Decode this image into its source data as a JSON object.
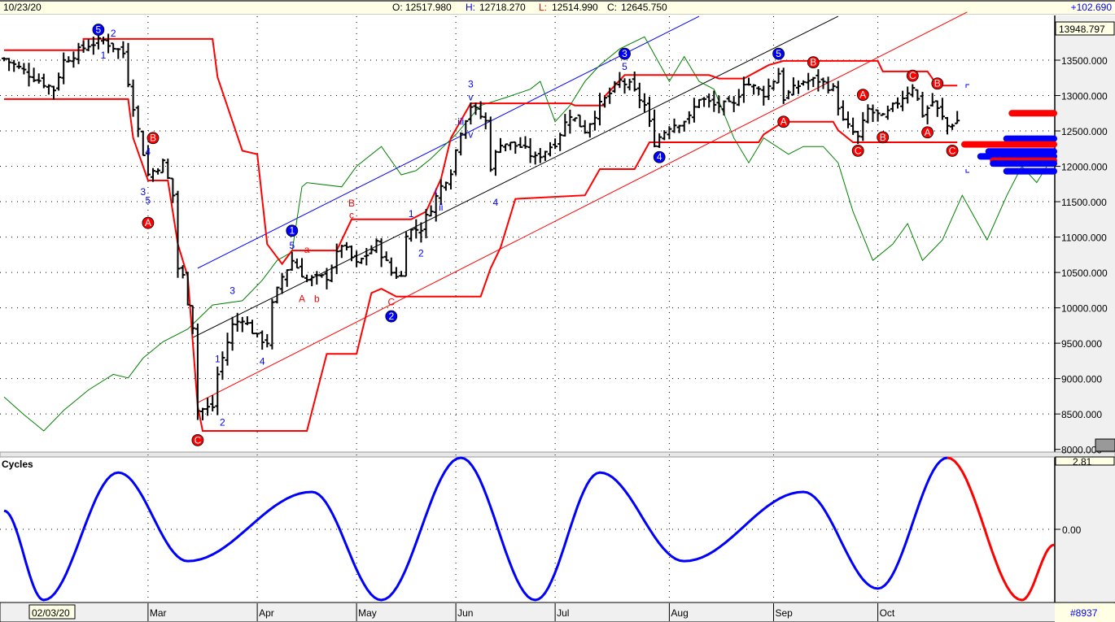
{
  "header": {
    "date": "10/23/20",
    "open_label": "O:",
    "open": "12517.980",
    "high_label": "H:",
    "high": "12718.270",
    "low_label": "L:",
    "low": "12514.990",
    "close_label": "C:",
    "close": "12645.750",
    "change": "+102.690"
  },
  "colors": {
    "up_down_bar": "#000000",
    "channel_band": "#ff0000",
    "green_line": "#008000",
    "blue": "#0000ff",
    "red": "#ff0000"
  },
  "footer": {
    "start_date": "02/03/20",
    "bar_count": "#8937"
  },
  "chart_data": [
    {
      "type": "line",
      "title": "Price (OHLC bars)",
      "ylim": [
        8000,
        14100
      ],
      "y_ticks": [
        "8000.000",
        "8500.000",
        "9000.000",
        "9500.000",
        "10000.000",
        "10500.000",
        "11000.000",
        "11500.000",
        "12000.000",
        "12500.000",
        "13000.000",
        "13500.000"
      ],
      "y_tick_values": [
        8000,
        8500,
        9000,
        9500,
        10000,
        10500,
        11000,
        11500,
        12000,
        12500,
        13000,
        13500
      ],
      "last_value_box": "13948.797",
      "x_days_total": 212,
      "month_ticks": [
        {
          "label": "Mar",
          "day": 29
        },
        {
          "label": "Apr",
          "day": 51
        },
        {
          "label": "May",
          "day": 71
        },
        {
          "label": "Jun",
          "day": 91
        },
        {
          "label": "Jul",
          "day": 111
        },
        {
          "label": "Aug",
          "day": 134
        },
        {
          "label": "Sep",
          "day": 155
        },
        {
          "label": "Oct",
          "day": 176
        }
      ],
      "close_path": [
        [
          0,
          13520
        ],
        [
          6,
          13260
        ],
        [
          10,
          13090
        ],
        [
          12,
          13490
        ],
        [
          17,
          13720
        ],
        [
          20,
          13780
        ],
        [
          24,
          13600
        ],
        [
          25,
          13200
        ],
        [
          27,
          12510
        ],
        [
          29,
          11880
        ],
        [
          32,
          12050
        ],
        [
          34,
          11590
        ],
        [
          35,
          10560
        ],
        [
          36,
          10440
        ],
        [
          38,
          9750
        ],
        [
          39,
          8550
        ],
        [
          42,
          8600
        ],
        [
          43,
          9060
        ],
        [
          46,
          9750
        ],
        [
          48,
          9860
        ],
        [
          51,
          9580
        ],
        [
          53,
          9520
        ],
        [
          54,
          10040
        ],
        [
          56,
          10440
        ],
        [
          58,
          10670
        ],
        [
          61,
          10390
        ],
        [
          65,
          10440
        ],
        [
          68,
          10900
        ],
        [
          71,
          10610
        ],
        [
          75,
          10900
        ],
        [
          78,
          10500
        ],
        [
          80,
          10440
        ],
        [
          81,
          11070
        ],
        [
          84,
          11130
        ],
        [
          88,
          11710
        ],
        [
          90,
          11940
        ],
        [
          92,
          12510
        ],
        [
          94,
          12860
        ],
        [
          97,
          12630
        ],
        [
          98,
          12000
        ],
        [
          100,
          12340
        ],
        [
          104,
          12280
        ],
        [
          107,
          12110
        ],
        [
          111,
          12340
        ],
        [
          114,
          12740
        ],
        [
          117,
          12510
        ],
        [
          120,
          12860
        ],
        [
          124,
          13200
        ],
        [
          126,
          13140
        ],
        [
          129,
          12860
        ],
        [
          131,
          12340
        ],
        [
          134,
          12570
        ],
        [
          138,
          12680
        ],
        [
          140,
          12970
        ],
        [
          143,
          12860
        ],
        [
          147,
          12860
        ],
        [
          149,
          13200
        ],
        [
          153,
          13030
        ],
        [
          156,
          13320
        ],
        [
          157,
          12970
        ],
        [
          161,
          13200
        ],
        [
          164,
          13220
        ],
        [
          167,
          13090
        ],
        [
          169,
          12630
        ],
        [
          172,
          12400
        ],
        [
          174,
          12800
        ],
        [
          177,
          12680
        ],
        [
          180,
          12910
        ],
        [
          183,
          13140
        ],
        [
          185,
          12740
        ],
        [
          187,
          12910
        ],
        [
          190,
          12570
        ],
        [
          192,
          12645
        ]
      ],
      "upper_band": [
        [
          0,
          13640
        ],
        [
          16,
          13640
        ],
        [
          16,
          13800
        ],
        [
          42,
          13800
        ],
        [
          43,
          13260
        ],
        [
          48,
          12220
        ],
        [
          51,
          12170
        ],
        [
          53,
          10900
        ],
        [
          56,
          10620
        ],
        [
          58,
          10810
        ],
        [
          67,
          10810
        ],
        [
          70,
          11250
        ],
        [
          82,
          11250
        ],
        [
          85,
          11360
        ],
        [
          88,
          11820
        ],
        [
          90,
          12400
        ],
        [
          94,
          12890
        ],
        [
          114,
          12890
        ],
        [
          115,
          12860
        ],
        [
          121,
          12860
        ],
        [
          121,
          12990
        ],
        [
          125,
          13290
        ],
        [
          142,
          13290
        ],
        [
          144,
          13240
        ],
        [
          149,
          13240
        ],
        [
          154,
          13430
        ],
        [
          157,
          13490
        ],
        [
          176,
          13490
        ],
        [
          177,
          13340
        ],
        [
          186,
          13340
        ],
        [
          188,
          13140
        ],
        [
          192,
          13140
        ]
      ],
      "lower_band": [
        [
          0,
          12950
        ],
        [
          25,
          12950
        ],
        [
          26,
          12400
        ],
        [
          29,
          11800
        ],
        [
          33,
          11800
        ],
        [
          35,
          10900
        ],
        [
          37,
          10440
        ],
        [
          39,
          8610
        ],
        [
          40,
          8260
        ],
        [
          61,
          8260
        ],
        [
          65,
          9350
        ],
        [
          71,
          9350
        ],
        [
          74,
          10210
        ],
        [
          76,
          10270
        ],
        [
          79,
          10160
        ],
        [
          96,
          10160
        ],
        [
          98,
          10560
        ],
        [
          100,
          10850
        ],
        [
          103,
          11540
        ],
        [
          117,
          11590
        ],
        [
          120,
          11960
        ],
        [
          127,
          11960
        ],
        [
          130,
          12340
        ],
        [
          152,
          12340
        ],
        [
          153,
          12450
        ],
        [
          157,
          12630
        ],
        [
          167,
          12630
        ],
        [
          168,
          12510
        ],
        [
          171,
          12340
        ],
        [
          192,
          12340
        ]
      ],
      "green_line": [
        [
          0,
          8740
        ],
        [
          4,
          8490
        ],
        [
          8,
          8260
        ],
        [
          12,
          8550
        ],
        [
          17,
          8840
        ],
        [
          22,
          9060
        ],
        [
          25,
          9010
        ],
        [
          28,
          9290
        ],
        [
          32,
          9520
        ],
        [
          37,
          9700
        ],
        [
          42,
          10040
        ],
        [
          48,
          10100
        ],
        [
          52,
          10390
        ],
        [
          55,
          10670
        ],
        [
          58,
          10790
        ],
        [
          60,
          11710
        ],
        [
          61,
          11770
        ],
        [
          68,
          11710
        ],
        [
          71,
          12000
        ],
        [
          76,
          12280
        ],
        [
          80,
          11880
        ],
        [
          83,
          11940
        ],
        [
          86,
          12110
        ],
        [
          91,
          12450
        ],
        [
          96,
          12860
        ],
        [
          101,
          12970
        ],
        [
          106,
          13090
        ],
        [
          108,
          13200
        ],
        [
          111,
          12630
        ],
        [
          114,
          12860
        ],
        [
          117,
          13200
        ],
        [
          120,
          13430
        ],
        [
          124,
          13660
        ],
        [
          129,
          13830
        ],
        [
          134,
          13200
        ],
        [
          137,
          13550
        ],
        [
          140,
          13200
        ],
        [
          143,
          13090
        ],
        [
          147,
          12400
        ],
        [
          150,
          12050
        ],
        [
          153,
          12400
        ],
        [
          158,
          12170
        ],
        [
          161,
          12280
        ],
        [
          165,
          12280
        ],
        [
          168,
          12050
        ],
        [
          171,
          11360
        ],
        [
          175,
          10670
        ],
        [
          179,
          10900
        ],
        [
          182,
          11190
        ],
        [
          185,
          10670
        ],
        [
          189,
          10960
        ],
        [
          193,
          11590
        ],
        [
          198,
          10960
        ],
        [
          202,
          11590
        ],
        [
          205,
          12000
        ],
        [
          208,
          11770
        ],
        [
          211,
          12110
        ]
      ],
      "trend_lines": [
        {
          "color": "#0000ff",
          "from": [
            39,
            10560
          ],
          "to": [
            140,
            14120
          ]
        },
        {
          "color": "#000000",
          "from": [
            38,
            9580
          ],
          "to": [
            168,
            14120
          ]
        },
        {
          "color": "#ff0000",
          "from": [
            39,
            8660
          ],
          "to": [
            194,
            14180
          ]
        }
      ],
      "volume_profile": [
        {
          "price": 12750,
          "size": 0.47,
          "color": "#ff0000"
        },
        {
          "price": 12390,
          "size": 0.53,
          "color": "#0000ff"
        },
        {
          "price": 12310,
          "size": 1.0,
          "color": "#ff0000"
        },
        {
          "price": 12210,
          "size": 0.73,
          "color": "#0000ff"
        },
        {
          "price": 12140,
          "size": 0.82,
          "color": "#0000ff"
        },
        {
          "price": 12080,
          "size": 0.68,
          "color": "#ff0000"
        },
        {
          "price": 12040,
          "size": 0.68,
          "color": "#0000ff"
        },
        {
          "price": 11930,
          "size": 0.53,
          "color": "#0000ff"
        }
      ],
      "wave_circles": [
        {
          "t": "5",
          "day": 19,
          "v": 13930,
          "c": "#0000ff"
        },
        {
          "t": "1",
          "day": 58,
          "v": 11090,
          "c": "#0000ff"
        },
        {
          "t": "2",
          "day": 78,
          "v": 9880,
          "c": "#0000ff"
        },
        {
          "t": "3",
          "day": 125,
          "v": 13590,
          "c": "#0000ff"
        },
        {
          "t": "4",
          "day": 132,
          "v": 12130,
          "c": "#0000ff"
        },
        {
          "t": "5",
          "day": 156,
          "v": 13590,
          "c": "#0000ff"
        },
        {
          "t": "B",
          "day": 30,
          "v": 12400,
          "c": "#ff0000"
        },
        {
          "t": "A",
          "day": 29,
          "v": 11200,
          "c": "#ff0000"
        },
        {
          "t": "C",
          "day": 39,
          "v": 8130,
          "c": "#ff0000"
        },
        {
          "t": "A",
          "day": 157,
          "v": 12630,
          "c": "#ff0000"
        },
        {
          "t": "B",
          "day": 163,
          "v": 13470,
          "c": "#ff0000"
        },
        {
          "t": "A",
          "day": 173,
          "v": 13010,
          "c": "#ff0000"
        },
        {
          "t": "C",
          "day": 172,
          "v": 12220,
          "c": "#ff0000"
        },
        {
          "t": "B",
          "day": 177,
          "v": 12410,
          "c": "#ff0000"
        },
        {
          "t": "C",
          "day": 183,
          "v": 13280,
          "c": "#ff0000"
        },
        {
          "t": "B",
          "day": 188,
          "v": 13170,
          "c": "#ff0000"
        },
        {
          "t": "A",
          "day": 186,
          "v": 12480,
          "c": "#ff0000"
        },
        {
          "t": "C",
          "day": 191,
          "v": 12220,
          "c": "#ff0000"
        }
      ],
      "wave_labels": [
        {
          "t": "2",
          "day": 22,
          "v": 13880,
          "c": "#0000ff"
        },
        {
          "t": "1",
          "day": 20,
          "v": 13570,
          "c": "#0000ff"
        },
        {
          "t": "4",
          "day": 29,
          "v": 12210,
          "c": "#0000ff"
        },
        {
          "t": "3",
          "day": 28,
          "v": 11640,
          "c": "#0000ff"
        },
        {
          "t": "5",
          "day": 29,
          "v": 11520,
          "c": "#0000ff"
        },
        {
          "t": "1",
          "day": 43,
          "v": 9280,
          "c": "#0000ff"
        },
        {
          "t": "2",
          "day": 44,
          "v": 8380,
          "c": "#0000ff"
        },
        {
          "t": "3",
          "day": 46,
          "v": 10240,
          "c": "#0000ff"
        },
        {
          "t": "4",
          "day": 52,
          "v": 9240,
          "c": "#0000ff"
        },
        {
          "t": "5",
          "day": 58,
          "v": 10880,
          "c": "#0000ff"
        },
        {
          "t": "1",
          "day": 82,
          "v": 11330,
          "c": "#0000ff"
        },
        {
          "t": "2",
          "day": 84,
          "v": 10770,
          "c": "#0000ff"
        },
        {
          "t": "3",
          "day": 94,
          "v": 13160,
          "c": "#0000ff"
        },
        {
          "t": "v",
          "day": 94,
          "v": 12980,
          "c": "#0000ff"
        },
        {
          "t": "iii",
          "day": 92,
          "v": 12630,
          "c": "#0000ff"
        },
        {
          "t": "v",
          "day": 94,
          "v": 12450,
          "c": "#0000ff"
        },
        {
          "t": "i",
          "day": 87,
          "v": 11640,
          "c": "#0000ff"
        },
        {
          "t": "ii",
          "day": 88,
          "v": 11420,
          "c": "#0000ff"
        },
        {
          "t": "4",
          "day": 99,
          "v": 11490,
          "c": "#0000ff"
        },
        {
          "t": "5",
          "day": 125,
          "v": 13410,
          "c": "#0000ff"
        },
        {
          "t": "B",
          "day": 70,
          "v": 11480,
          "c": "#ff0000"
        },
        {
          "t": "c",
          "day": 70,
          "v": 11310,
          "c": "#ff0000"
        },
        {
          "t": "a",
          "day": 61,
          "v": 10820,
          "c": "#ff0000"
        },
        {
          "t": "A",
          "day": 60,
          "v": 10130,
          "c": "#ff0000"
        },
        {
          "t": "b",
          "day": 63,
          "v": 10130,
          "c": "#ff0000"
        },
        {
          "t": "C",
          "day": 78,
          "v": 10080,
          "c": "#ff0000"
        }
      ]
    },
    {
      "type": "line",
      "title": "Cycles",
      "ylim": [
        -2.85,
        2.81
      ],
      "max_label": "2.81",
      "zero_label": "0.00",
      "projection_start_day": 190,
      "extrema": [
        [
          0,
          0.73
        ],
        [
          8,
          -2.78
        ],
        [
          23,
          2.23
        ],
        [
          37,
          -1.25
        ],
        [
          62,
          1.47
        ],
        [
          76,
          -2.78
        ],
        [
          92,
          2.81
        ],
        [
          107,
          -2.78
        ],
        [
          120,
          2.23
        ],
        [
          137,
          -1.25
        ],
        [
          161,
          1.47
        ],
        [
          176,
          -2.33
        ],
        [
          190,
          2.81
        ],
        [
          205,
          -2.78
        ],
        [
          211.5,
          -0.61
        ]
      ]
    }
  ]
}
